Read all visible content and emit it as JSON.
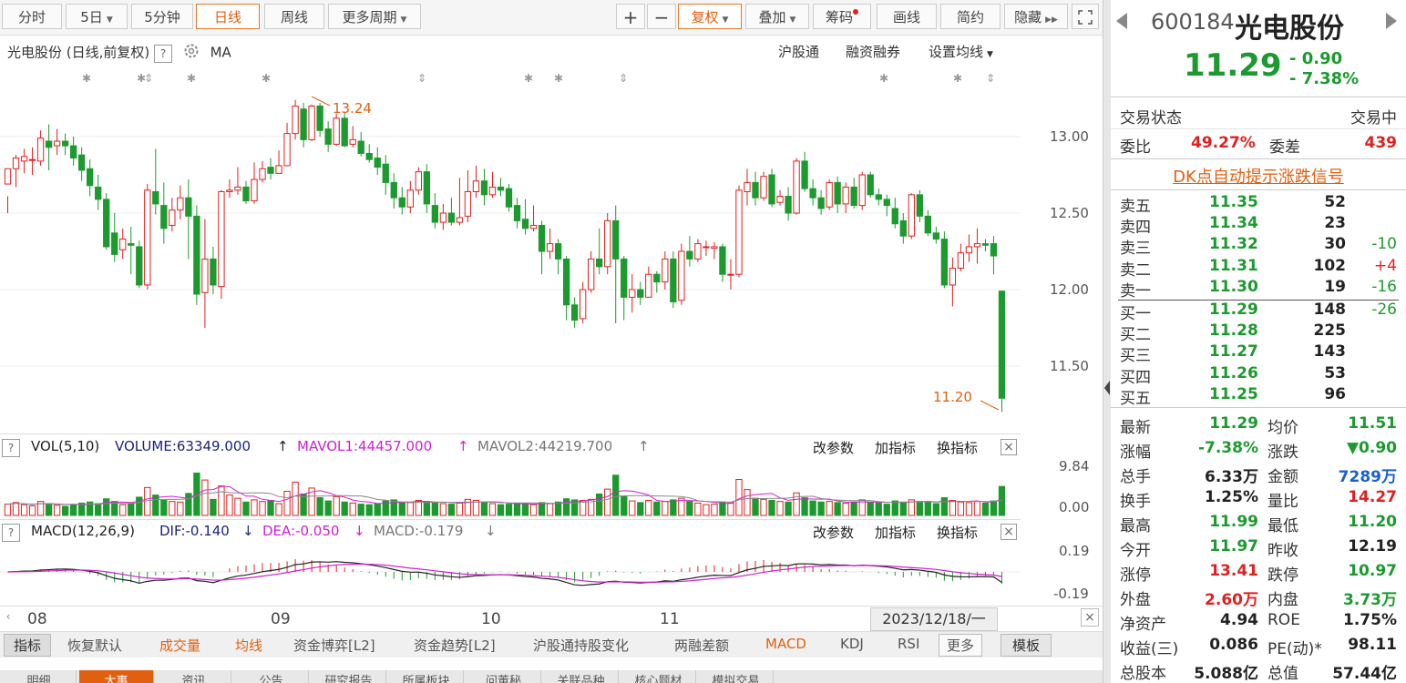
{
  "toolbar": {
    "tabs": [
      "分时",
      "5日",
      "5分钟",
      "日线",
      "周线",
      "更多周期"
    ],
    "active_tab": "日线",
    "buttons": [
      "+",
      "−",
      "复权",
      "叠加",
      "筹码",
      "画线",
      "简约",
      "隐藏"
    ]
  },
  "chart_header": {
    "title": "光电股份 (日线,前复权)",
    "indicator": "MA",
    "links": [
      "沪股通",
      "融资融券",
      "设置均线"
    ]
  },
  "price_axis": [
    "13.00",
    "12.50",
    "12.00",
    "11.50"
  ],
  "annotations": {
    "high": "13.24",
    "low": "11.20"
  },
  "vol_header": {
    "name": "VOL(5,10)",
    "volume": "VOLUME:63349.000",
    "mavol1": "MAVOL1:44457.000",
    "mavol2": "MAVOL2:44219.700",
    "actions": [
      "改参数",
      "加指标",
      "换指标"
    ],
    "axis": [
      "9.84",
      "0.00"
    ]
  },
  "macd_header": {
    "name": "MACD(12,26,9)",
    "dif": "DIF:-0.140",
    "dea": "DEA:-0.050",
    "macd": "MACD:-0.179",
    "actions": [
      "改参数",
      "加指标",
      "换指标"
    ],
    "axis": [
      "0.19",
      "-0.19"
    ]
  },
  "date_axis": {
    "labels": [
      "08",
      "09",
      "10",
      "11"
    ],
    "cursor_date": "2023/12/18/一"
  },
  "bottom_bar": [
    "指标",
    "恢复默认",
    "成交量",
    "均线",
    "资金博弈[L2]",
    "资金趋势[L2]",
    "沪股通持股变化",
    "两融差额",
    "MACD",
    "KDJ",
    "RSI",
    "更多",
    "模板"
  ],
  "bottom_tabs": [
    "明细",
    "大事",
    "资讯",
    "公告",
    "研究报告",
    "所属板块",
    "问董秘",
    "关联品种",
    "核心题材",
    "模拟交易"
  ],
  "quote": {
    "code": "600184",
    "name": "光电股份",
    "price": "11.29",
    "change": "- 0.90",
    "change_pct": "- 7.38%",
    "status_label": "交易状态",
    "status_value": "交易中",
    "weibi_label": "委比",
    "weibi_value": "49.27%",
    "weicha_label": "委差",
    "weicha_value": "439",
    "signal_link": "DK点自动提示涨跌信号"
  },
  "order_book": {
    "asks": [
      {
        "label": "卖五",
        "price": "11.35",
        "vol": "52",
        "chg": ""
      },
      {
        "label": "卖四",
        "price": "11.34",
        "vol": "23",
        "chg": ""
      },
      {
        "label": "卖三",
        "price": "11.32",
        "vol": "30",
        "chg": "-10"
      },
      {
        "label": "卖二",
        "price": "11.31",
        "vol": "102",
        "chg": "+4"
      },
      {
        "label": "卖一",
        "price": "11.30",
        "vol": "19",
        "chg": "-16"
      }
    ],
    "bids": [
      {
        "label": "买一",
        "price": "11.29",
        "vol": "148",
        "chg": "-26"
      },
      {
        "label": "买二",
        "price": "11.28",
        "vol": "225",
        "chg": ""
      },
      {
        "label": "买三",
        "price": "11.27",
        "vol": "143",
        "chg": ""
      },
      {
        "label": "买四",
        "price": "11.26",
        "vol": "53",
        "chg": ""
      },
      {
        "label": "买五",
        "price": "11.25",
        "vol": "96",
        "chg": ""
      }
    ]
  },
  "stats": [
    {
      "l1": "最新",
      "v1": "11.29",
      "c1": "g",
      "l2": "均价",
      "v2": "11.51",
      "c2": "g"
    },
    {
      "l1": "涨幅",
      "v1": "-7.38%",
      "c1": "g",
      "l2": "涨跌",
      "v2": "▼0.90",
      "c2": "g"
    },
    {
      "l1": "总手",
      "v1": "6.33万",
      "c1": "k",
      "l2": "金额",
      "v2": "7289万",
      "c2": "b"
    },
    {
      "l1": "换手",
      "v1": "1.25%",
      "c1": "k",
      "l2": "量比",
      "v2": "14.27",
      "c2": "r"
    },
    {
      "l1": "最高",
      "v1": "11.99",
      "c1": "g",
      "l2": "最低",
      "v2": "11.20",
      "c2": "g"
    },
    {
      "l1": "今开",
      "v1": "11.97",
      "c1": "g",
      "l2": "昨收",
      "v2": "12.19",
      "c2": "k"
    },
    {
      "l1": "涨停",
      "v1": "13.41",
      "c1": "r",
      "l2": "跌停",
      "v2": "10.97",
      "c2": "g"
    },
    {
      "l1": "外盘",
      "v1": "2.60万",
      "c1": "r",
      "l2": "内盘",
      "v2": "3.73万",
      "c2": "g"
    },
    {
      "l1": "净资产",
      "v1": "4.94",
      "c1": "k",
      "l2": "ROE",
      "v2": "1.75%",
      "c2": "k"
    },
    {
      "l1": "收益(三)",
      "v1": "0.086",
      "c1": "k",
      "l2": "PE(动)*",
      "v2": "98.11",
      "c2": "k"
    },
    {
      "l1": "总股本",
      "v1": "5.088亿",
      "c1": "k",
      "l2": "总值",
      "v2": "57.44亿",
      "c2": "k"
    }
  ],
  "colors": {
    "up": "#e02020",
    "down": "#1c9a2f",
    "accent": "#e06010",
    "ma1": "#d020d0",
    "link": "#1a5fd0"
  },
  "candles": [
    [
      12.69,
      12.79,
      12.61,
      12.5
    ],
    [
      12.79,
      12.86,
      12.88,
      12.67
    ],
    [
      12.84,
      12.87,
      12.92,
      12.76
    ],
    [
      12.85,
      12.85,
      12.93,
      12.75
    ],
    [
      12.84,
      12.99,
      13.04,
      12.81
    ],
    [
      12.97,
      12.93,
      13.08,
      12.78
    ],
    [
      12.94,
      12.97,
      13.05,
      12.88
    ],
    [
      12.97,
      12.94,
      13.02,
      12.88
    ],
    [
      12.94,
      12.86,
      13.0,
      12.81
    ],
    [
      12.88,
      12.78,
      12.93,
      12.71
    ],
    [
      12.79,
      12.68,
      12.85,
      12.61
    ],
    [
      12.67,
      12.59,
      12.75,
      12.52
    ],
    [
      12.59,
      12.28,
      12.63,
      12.26
    ],
    [
      12.37,
      12.23,
      12.5,
      12.18
    ],
    [
      12.26,
      12.33,
      12.4,
      12.2
    ],
    [
      12.3,
      12.29,
      12.41,
      12.1
    ],
    [
      12.28,
      12.03,
      12.32,
      12.01
    ],
    [
      12.03,
      12.65,
      12.69,
      12.0
    ],
    [
      12.64,
      12.56,
      12.92,
      12.49
    ],
    [
      12.55,
      12.4,
      12.7,
      12.3
    ],
    [
      12.42,
      12.52,
      12.6,
      12.38
    ],
    [
      12.52,
      12.6,
      12.68,
      12.46
    ],
    [
      12.6,
      12.48,
      12.72,
      12.2
    ],
    [
      12.48,
      11.97,
      12.55,
      11.9
    ],
    [
      11.98,
      12.2,
      12.46,
      11.75
    ],
    [
      12.2,
      12.03,
      12.28,
      11.97
    ],
    [
      12.02,
      12.64,
      12.65,
      11.94
    ],
    [
      12.64,
      12.65,
      12.72,
      12.6
    ],
    [
      12.65,
      12.67,
      12.8,
      12.62
    ],
    [
      12.67,
      12.58,
      12.71,
      12.56
    ],
    [
      12.58,
      12.72,
      12.83,
      12.56
    ],
    [
      12.72,
      12.79,
      12.84,
      12.7
    ],
    [
      12.8,
      12.76,
      12.86,
      12.72
    ],
    [
      12.76,
      12.81,
      12.91,
      12.76
    ],
    [
      12.81,
      13.02,
      13.09,
      12.82
    ],
    [
      13.02,
      13.2,
      13.24,
      12.98
    ],
    [
      13.18,
      12.98,
      13.22,
      12.93
    ],
    [
      12.98,
      13.2,
      13.21,
      12.97
    ],
    [
      13.2,
      13.04,
      13.22,
      13.0
    ],
    [
      13.05,
      12.95,
      13.1,
      12.9
    ],
    [
      12.95,
      13.12,
      13.15,
      12.94
    ],
    [
      13.12,
      12.94,
      13.16,
      12.93
    ],
    [
      12.95,
      12.98,
      13.07,
      12.93
    ],
    [
      12.97,
      12.89,
      13.03,
      12.87
    ],
    [
      12.89,
      12.85,
      12.95,
      12.83
    ],
    [
      12.86,
      12.8,
      12.93,
      12.75
    ],
    [
      12.82,
      12.7,
      12.88,
      12.62
    ],
    [
      12.7,
      12.6,
      12.76,
      12.53
    ],
    [
      12.6,
      12.54,
      12.67,
      12.49
    ],
    [
      12.54,
      12.65,
      12.71,
      12.5
    ],
    [
      12.65,
      12.77,
      12.8,
      12.62
    ],
    [
      12.77,
      12.56,
      12.82,
      12.5
    ],
    [
      12.55,
      12.44,
      12.63,
      12.4
    ],
    [
      12.44,
      12.5,
      12.56,
      12.39
    ],
    [
      12.5,
      12.44,
      12.6,
      12.42
    ],
    [
      12.44,
      12.47,
      12.73,
      12.42
    ],
    [
      12.48,
      12.64,
      12.78,
      12.44
    ],
    [
      12.64,
      12.71,
      12.81,
      12.6
    ],
    [
      12.71,
      12.62,
      12.79,
      12.55
    ],
    [
      12.62,
      12.67,
      12.77,
      12.6
    ],
    [
      12.67,
      12.65,
      12.73,
      12.61
    ],
    [
      12.66,
      12.54,
      12.69,
      12.51
    ],
    [
      12.55,
      12.45,
      12.6,
      12.4
    ],
    [
      12.46,
      12.4,
      12.59,
      12.36
    ],
    [
      12.4,
      12.42,
      12.55,
      12.38
    ],
    [
      12.42,
      12.25,
      12.45,
      12.1
    ],
    [
      12.25,
      12.3,
      12.4,
      12.2
    ],
    [
      12.3,
      12.2,
      12.33,
      12.1
    ],
    [
      12.2,
      11.9,
      12.22,
      11.8
    ],
    [
      11.9,
      11.8,
      11.95,
      11.75
    ],
    [
      11.81,
      12.0,
      12.05,
      11.78
    ],
    [
      12.0,
      12.2,
      12.25,
      11.98
    ],
    [
      12.2,
      12.15,
      12.4,
      12.1
    ],
    [
      12.15,
      12.45,
      12.5,
      12.1
    ],
    [
      12.45,
      12.2,
      12.55,
      11.78
    ],
    [
      12.2,
      11.95,
      12.22,
      11.8
    ],
    [
      11.95,
      12.0,
      12.1,
      11.85
    ],
    [
      12.0,
      11.95,
      12.05,
      11.9
    ],
    [
      11.95,
      12.1,
      12.15,
      11.95
    ],
    [
      12.1,
      12.05,
      12.12,
      11.98
    ],
    [
      12.05,
      12.2,
      12.25,
      12.0
    ],
    [
      12.2,
      11.92,
      12.25,
      11.88
    ],
    [
      11.93,
      12.25,
      12.3,
      11.9
    ],
    [
      12.25,
      12.2,
      12.35,
      12.15
    ],
    [
      12.2,
      12.3,
      12.33,
      12.18
    ],
    [
      12.28,
      12.28,
      12.32,
      12.22
    ],
    [
      12.27,
      12.28,
      12.31,
      12.2
    ],
    [
      12.28,
      12.1,
      12.3,
      12.05
    ],
    [
      12.1,
      12.1,
      12.2,
      12.0
    ],
    [
      12.1,
      12.65,
      12.68,
      12.08
    ],
    [
      12.64,
      12.7,
      12.79,
      12.55
    ],
    [
      12.7,
      12.6,
      12.77,
      12.55
    ],
    [
      12.6,
      12.74,
      12.77,
      12.58
    ],
    [
      12.75,
      12.56,
      12.79,
      12.54
    ],
    [
      12.57,
      12.61,
      12.65,
      12.55
    ],
    [
      12.61,
      12.5,
      12.67,
      12.45
    ],
    [
      12.5,
      12.84,
      12.86,
      12.49
    ],
    [
      12.84,
      12.66,
      12.9,
      12.64
    ],
    [
      12.66,
      12.6,
      12.72,
      12.55
    ],
    [
      12.6,
      12.53,
      12.65,
      12.49
    ],
    [
      12.54,
      12.7,
      12.72,
      12.52
    ],
    [
      12.7,
      12.56,
      12.74,
      12.5
    ],
    [
      12.56,
      12.67,
      12.7,
      12.5
    ],
    [
      12.67,
      12.55,
      12.73,
      12.53
    ],
    [
      12.55,
      12.75,
      12.77,
      12.52
    ],
    [
      12.75,
      12.62,
      12.77,
      12.6
    ],
    [
      12.62,
      12.59,
      12.66,
      12.55
    ],
    [
      12.59,
      12.55,
      12.62,
      12.48
    ],
    [
      12.53,
      12.43,
      12.6,
      12.4
    ],
    [
      12.45,
      12.35,
      12.5,
      12.3
    ],
    [
      12.35,
      12.62,
      12.63,
      12.33
    ],
    [
      12.62,
      12.48,
      12.65,
      12.44
    ],
    [
      12.48,
      12.37,
      12.52,
      12.35
    ],
    [
      12.37,
      12.33,
      12.41,
      12.3
    ],
    [
      12.33,
      12.03,
      12.38,
      12.01
    ],
    [
      12.03,
      12.14,
      12.21,
      11.89
    ],
    [
      12.14,
      12.24,
      12.3,
      12.12
    ],
    [
      12.24,
      12.28,
      12.36,
      12.18
    ],
    [
      12.28,
      12.3,
      12.4,
      12.17
    ],
    [
      12.3,
      12.29,
      12.33,
      12.25
    ],
    [
      12.3,
      12.22,
      12.35,
      12.1
    ],
    [
      11.99,
      11.29,
      11.99,
      11.2
    ]
  ],
  "volumes": [
    2.1,
    2.4,
    2.0,
    1.8,
    2.6,
    2.2,
    1.9,
    1.7,
    2.0,
    2.3,
    2.5,
    2.2,
    3.1,
    2.6,
    2.0,
    2.2,
    3.4,
    5.2,
    3.8,
    2.8,
    2.6,
    2.5,
    4.1,
    7.9,
    6.6,
    3.0,
    5.5,
    3.8,
    3.2,
    2.5,
    2.9,
    2.6,
    2.8,
    2.2,
    4.5,
    6.2,
    4.0,
    5.1,
    3.3,
    2.7,
    3.5,
    2.5,
    2.3,
    2.1,
    2.0,
    2.2,
    2.7,
    2.9,
    2.3,
    2.4,
    2.8,
    2.6,
    2.4,
    2.2,
    2.1,
    2.3,
    3.0,
    2.8,
    2.4,
    2.2,
    2.0,
    2.1,
    2.3,
    2.2,
    2.0,
    2.4,
    2.2,
    2.5,
    3.1,
    2.9,
    2.8,
    3.0,
    4.0,
    4.9,
    7.5,
    3.6,
    2.7,
    2.4,
    2.8,
    2.5,
    2.6,
    2.9,
    3.2,
    2.6,
    2.3,
    2.0,
    2.1,
    2.4,
    2.3,
    6.7,
    4.8,
    3.2,
    3.0,
    2.8,
    2.6,
    2.5,
    4.2,
    3.3,
    2.7,
    2.5,
    2.6,
    2.4,
    2.3,
    2.5,
    2.9,
    2.4,
    2.3,
    2.1,
    2.7,
    2.5,
    2.9,
    2.6,
    2.4,
    2.2,
    3.3,
    2.8,
    2.5,
    2.4,
    2.6,
    2.3,
    2.7,
    5.4
  ]
}
